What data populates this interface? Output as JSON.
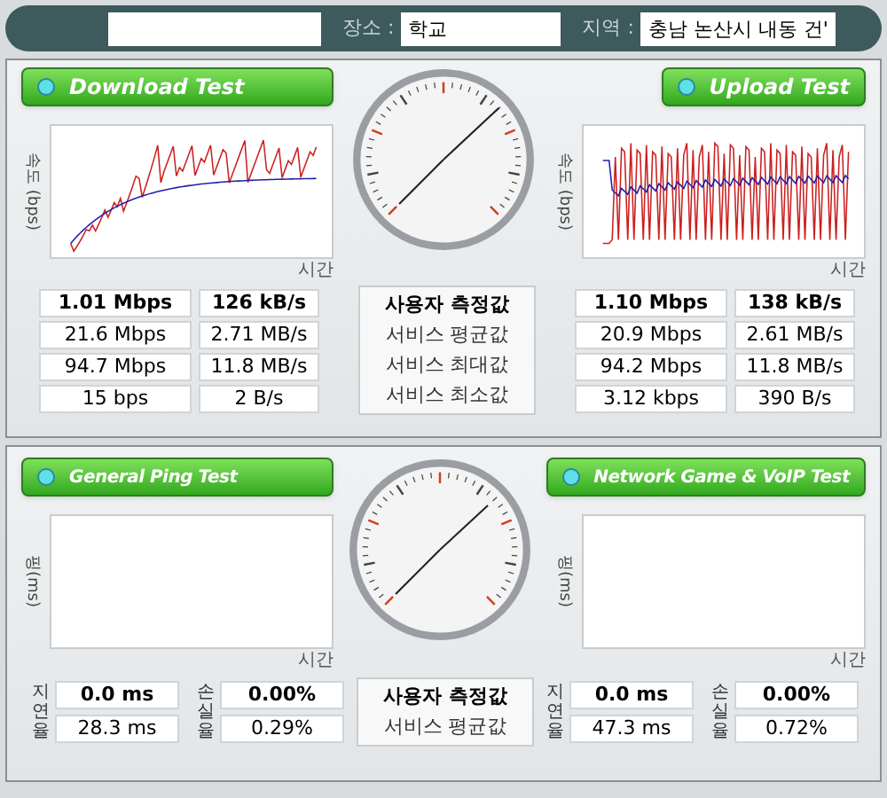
{
  "info_bar": {
    "fields": [
      {
        "label": "장소 :",
        "value": "학교"
      },
      {
        "label": "지역 :",
        "value": "충남 논산시 내동 건'"
      }
    ]
  },
  "speed_test": {
    "center_labels": [
      {
        "text": "사용자 측정값",
        "emphasized": true
      },
      {
        "text": "서비스 평균값",
        "emphasized": false
      },
      {
        "text": "서비스 최대값",
        "emphasized": false
      },
      {
        "text": "서비스 최소값",
        "emphasized": false
      }
    ],
    "download": {
      "title": "Download Test",
      "y_label": "속도 (bps)",
      "x_label": "시간",
      "rows": [
        {
          "bits": "1.01 Mbps",
          "bytes": "126 kB/s",
          "emphasized": true
        },
        {
          "bits": "21.6 Mbps",
          "bytes": "2.71 MB/s",
          "emphasized": false
        },
        {
          "bits": "94.7 Mbps",
          "bytes": "11.8 MB/s",
          "emphasized": false
        },
        {
          "bits": "15 bps",
          "bytes": "2 B/s",
          "emphasized": false
        }
      ]
    },
    "upload": {
      "title": "Upload Test",
      "y_label": "속도 (bps)",
      "x_label": "시간",
      "rows": [
        {
          "bits": "1.10 Mbps",
          "bytes": "138 kB/s",
          "emphasized": true
        },
        {
          "bits": "20.9 Mbps",
          "bytes": "2.61 MB/s",
          "emphasized": false
        },
        {
          "bits": "94.2 Mbps",
          "bytes": "11.8 MB/s",
          "emphasized": false
        },
        {
          "bits": "3.12 kbps",
          "bytes": "390 B/s",
          "emphasized": false
        }
      ]
    }
  },
  "ping_test": {
    "center_labels": [
      {
        "text": "사용자 측정값",
        "emphasized": true
      },
      {
        "text": "서비스 평균값",
        "emphasized": false
      }
    ],
    "general": {
      "title": "General Ping Test",
      "y_label": "핑(ms)",
      "x_label": "시간",
      "delay_label": "지연율",
      "loss_label": "손실율",
      "rows": [
        {
          "delay": "0.0 ms",
          "loss": "0.00%",
          "emphasized": true
        },
        {
          "delay": "28.3 ms",
          "loss": "0.29%",
          "emphasized": false
        }
      ]
    },
    "game_voip": {
      "title": "Network Game & VoIP Test",
      "y_label": "핑(ms)",
      "x_label": "시간",
      "delay_label": "지연율",
      "loss_label": "손실율",
      "rows": [
        {
          "delay": "0.0 ms",
          "loss": "0.00%",
          "emphasized": true
        },
        {
          "delay": "47.3 ms",
          "loss": "0.72%",
          "emphasized": false
        }
      ]
    }
  }
}
